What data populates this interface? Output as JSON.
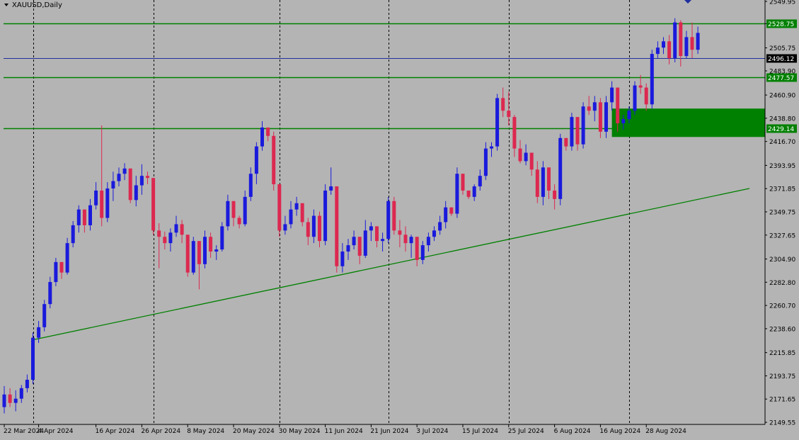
{
  "header": {
    "symbol_label": "XAUUSD,Daily",
    "menu_icon": "triangle-down-icon"
  },
  "colors": {
    "background": "#b4b4b4",
    "bull_candle": "#1a1adc",
    "bear_candle": "#dc2850",
    "level_line": "#008000",
    "price_line": "#1f2f9f",
    "zone_fill": "#008000",
    "grid": "#000000"
  },
  "chart_data": {
    "type": "candlestick",
    "title": "XAUUSD,Daily",
    "ylim": [
      2149.55,
      2549.95
    ],
    "y_ticks": [
      "2549.95",
      "2528.75",
      "2505.75",
      "2483.90",
      "2460.90",
      "2438.80",
      "2416.70",
      "2393.95",
      "2371.85",
      "2349.75",
      "2327.65",
      "2304.90",
      "2282.80",
      "2260.70",
      "2238.60",
      "2215.85",
      "2193.75",
      "2171.65",
      "2149.55"
    ],
    "x_ticks": [
      {
        "label": "22 Mar 2024",
        "index": 0
      },
      {
        "label": "4 Apr 2024",
        "index": 6
      },
      {
        "label": "16 Apr 2024",
        "index": 16
      },
      {
        "label": "26 Apr 2024",
        "index": 24
      },
      {
        "label": "8 May 2024",
        "index": 32
      },
      {
        "label": "20 May 2024",
        "index": 40
      },
      {
        "label": "30 May 2024",
        "index": 48
      },
      {
        "label": "11 Jun 2024",
        "index": 56
      },
      {
        "label": "21 Jun 2024",
        "index": 64
      },
      {
        "label": "3 Jul 2024",
        "index": 72
      },
      {
        "label": "15 Jul 2024",
        "index": 80
      },
      {
        "label": "25 Jul 2024",
        "index": 88
      },
      {
        "label": "6 Aug 2024",
        "index": 96
      },
      {
        "label": "16 Aug 2024",
        "index": 104
      },
      {
        "label": "28 Aug 2024",
        "index": 112
      }
    ],
    "vertical_grid_at": [
      5,
      26,
      48,
      67,
      88,
      109
    ],
    "levels": [
      {
        "name": "resistance",
        "value": 2528.75,
        "label": "2528.75",
        "color": "#008000"
      },
      {
        "name": "current",
        "value": 2496.12,
        "label": "2496.12",
        "color": "#1f2f9f"
      },
      {
        "name": "support-1",
        "value": 2477.57,
        "label": "2477.57",
        "color": "#008000"
      },
      {
        "name": "support-2",
        "value": 2429.14,
        "label": "2429.14",
        "color": "#008000"
      }
    ],
    "zone": {
      "from_index": 106,
      "y_top": 2448,
      "y_bottom": 2421
    },
    "trendline": {
      "from_index": 5,
      "from_value": 2228,
      "to_index": 130,
      "to_value": 2372
    },
    "candles": [
      [
        2164,
        2184,
        2158,
        2176
      ],
      [
        2176,
        2182,
        2164,
        2168
      ],
      [
        2168,
        2180,
        2160,
        2172
      ],
      [
        2172,
        2185,
        2168,
        2182
      ],
      [
        2182,
        2195,
        2178,
        2190
      ],
      [
        2190,
        2235,
        2186,
        2230
      ],
      [
        2230,
        2246,
        2225,
        2240
      ],
      [
        2240,
        2266,
        2236,
        2262
      ],
      [
        2262,
        2288,
        2258,
        2283
      ],
      [
        2283,
        2306,
        2279,
        2302
      ],
      [
        2302,
        2300,
        2286,
        2292
      ],
      [
        2292,
        2325,
        2290,
        2320
      ],
      [
        2320,
        2341,
        2316,
        2337
      ],
      [
        2337,
        2356,
        2330,
        2352
      ],
      [
        2352,
        2345,
        2330,
        2337
      ],
      [
        2337,
        2362,
        2332,
        2356
      ],
      [
        2356,
        2378,
        2352,
        2370
      ],
      [
        2370,
        2432,
        2336,
        2344
      ],
      [
        2344,
        2378,
        2340,
        2372
      ],
      [
        2372,
        2388,
        2360,
        2379
      ],
      [
        2379,
        2392,
        2374,
        2386
      ],
      [
        2386,
        2396,
        2380,
        2391
      ],
      [
        2391,
        2372,
        2358,
        2361
      ],
      [
        2361,
        2384,
        2355,
        2375
      ],
      [
        2375,
        2395,
        2366,
        2384
      ],
      [
        2384,
        2388,
        2376,
        2382
      ],
      [
        2382,
        2360,
        2328,
        2332
      ],
      [
        2332,
        2339,
        2296,
        2326
      ],
      [
        2326,
        2331,
        2314,
        2320
      ],
      [
        2320,
        2334,
        2312,
        2330
      ],
      [
        2330,
        2346,
        2326,
        2338
      ],
      [
        2338,
        2342,
        2320,
        2328
      ],
      [
        2328,
        2326,
        2288,
        2292
      ],
      [
        2292,
        2326,
        2290,
        2322
      ],
      [
        2322,
        2314,
        2276,
        2300
      ],
      [
        2300,
        2332,
        2296,
        2326
      ],
      [
        2326,
        2330,
        2306,
        2312
      ],
      [
        2312,
        2318,
        2304,
        2314
      ],
      [
        2314,
        2340,
        2312,
        2336
      ],
      [
        2336,
        2366,
        2332,
        2360
      ],
      [
        2360,
        2356,
        2336,
        2344
      ],
      [
        2344,
        2346,
        2334,
        2338
      ],
      [
        2338,
        2370,
        2336,
        2364
      ],
      [
        2364,
        2392,
        2360,
        2386
      ],
      [
        2386,
        2416,
        2376,
        2412
      ],
      [
        2412,
        2436,
        2408,
        2430
      ],
      [
        2430,
        2426,
        2417,
        2422
      ],
      [
        2422,
        2426,
        2370,
        2376
      ],
      [
        2376,
        2374,
        2326,
        2332
      ],
      [
        2332,
        2346,
        2328,
        2338
      ],
      [
        2338,
        2360,
        2334,
        2352
      ],
      [
        2352,
        2364,
        2346,
        2358
      ],
      [
        2358,
        2356,
        2336,
        2340
      ],
      [
        2340,
        2344,
        2318,
        2326
      ],
      [
        2326,
        2352,
        2320,
        2346
      ],
      [
        2346,
        2350,
        2316,
        2322
      ],
      [
        2322,
        2376,
        2318,
        2370
      ],
      [
        2370,
        2392,
        2366,
        2374
      ],
      [
        2374,
        2366,
        2292,
        2298
      ],
      [
        2298,
        2320,
        2292,
        2312
      ],
      [
        2312,
        2324,
        2304,
        2318
      ],
      [
        2318,
        2332,
        2314,
        2326
      ],
      [
        2326,
        2322,
        2300,
        2308
      ],
      [
        2308,
        2342,
        2306,
        2332
      ],
      [
        2332,
        2340,
        2322,
        2336
      ],
      [
        2336,
        2334,
        2316,
        2322
      ],
      [
        2322,
        2330,
        2312,
        2324
      ],
      [
        2324,
        2364,
        2320,
        2360
      ],
      [
        2360,
        2364,
        2328,
        2332
      ],
      [
        2332,
        2342,
        2316,
        2328
      ],
      [
        2328,
        2336,
        2312,
        2320
      ],
      [
        2320,
        2328,
        2306,
        2326
      ],
      [
        2326,
        2320,
        2298,
        2304
      ],
      [
        2304,
        2322,
        2300,
        2318
      ],
      [
        2318,
        2330,
        2312,
        2326
      ],
      [
        2326,
        2336,
        2322,
        2332
      ],
      [
        2332,
        2346,
        2328,
        2340
      ],
      [
        2340,
        2360,
        2334,
        2354
      ],
      [
        2354,
        2350,
        2346,
        2348
      ],
      [
        2348,
        2392,
        2344,
        2386
      ],
      [
        2386,
        2382,
        2366,
        2370
      ],
      [
        2370,
        2370,
        2362,
        2364
      ],
      [
        2364,
        2376,
        2360,
        2374
      ],
      [
        2374,
        2390,
        2370,
        2384
      ],
      [
        2384,
        2416,
        2380,
        2410
      ],
      [
        2410,
        2416,
        2402,
        2412
      ],
      [
        2412,
        2462,
        2408,
        2458
      ],
      [
        2458,
        2468,
        2440,
        2446
      ],
      [
        2446,
        2464,
        2432,
        2440
      ],
      [
        2440,
        2442,
        2402,
        2410
      ],
      [
        2410,
        2418,
        2396,
        2398
      ],
      [
        2398,
        2414,
        2394,
        2406
      ],
      [
        2406,
        2404,
        2384,
        2390
      ],
      [
        2390,
        2398,
        2358,
        2364
      ],
      [
        2364,
        2398,
        2356,
        2392
      ],
      [
        2392,
        2384,
        2362,
        2370
      ],
      [
        2370,
        2376,
        2352,
        2362
      ],
      [
        2362,
        2424,
        2356,
        2420
      ],
      [
        2420,
        2416,
        2408,
        2412
      ],
      [
        2412,
        2444,
        2408,
        2440
      ],
      [
        2440,
        2434,
        2408,
        2414
      ],
      [
        2414,
        2454,
        2410,
        2450
      ],
      [
        2450,
        2460,
        2442,
        2446
      ],
      [
        2446,
        2460,
        2436,
        2454
      ],
      [
        2454,
        2458,
        2420,
        2426
      ],
      [
        2426,
        2460,
        2420,
        2454
      ],
      [
        2454,
        2474,
        2446,
        2468
      ],
      [
        2468,
        2464,
        2426,
        2434
      ],
      [
        2434,
        2442,
        2428,
        2438
      ],
      [
        2438,
        2450,
        2434,
        2446
      ],
      [
        2446,
        2474,
        2442,
        2470
      ],
      [
        2470,
        2480,
        2462,
        2468
      ],
      [
        2468,
        2472,
        2446,
        2452
      ],
      [
        2452,
        2504,
        2448,
        2500
      ],
      [
        2500,
        2512,
        2496,
        2506
      ],
      [
        2506,
        2516,
        2500,
        2512
      ],
      [
        2512,
        2518,
        2490,
        2496
      ],
      [
        2496,
        2534,
        2492,
        2530
      ],
      [
        2530,
        2532,
        2488,
        2498
      ],
      [
        2498,
        2522,
        2496,
        2516
      ],
      [
        2516,
        2530,
        2496,
        2504
      ],
      [
        2504,
        2526,
        2500,
        2520
      ]
    ]
  }
}
